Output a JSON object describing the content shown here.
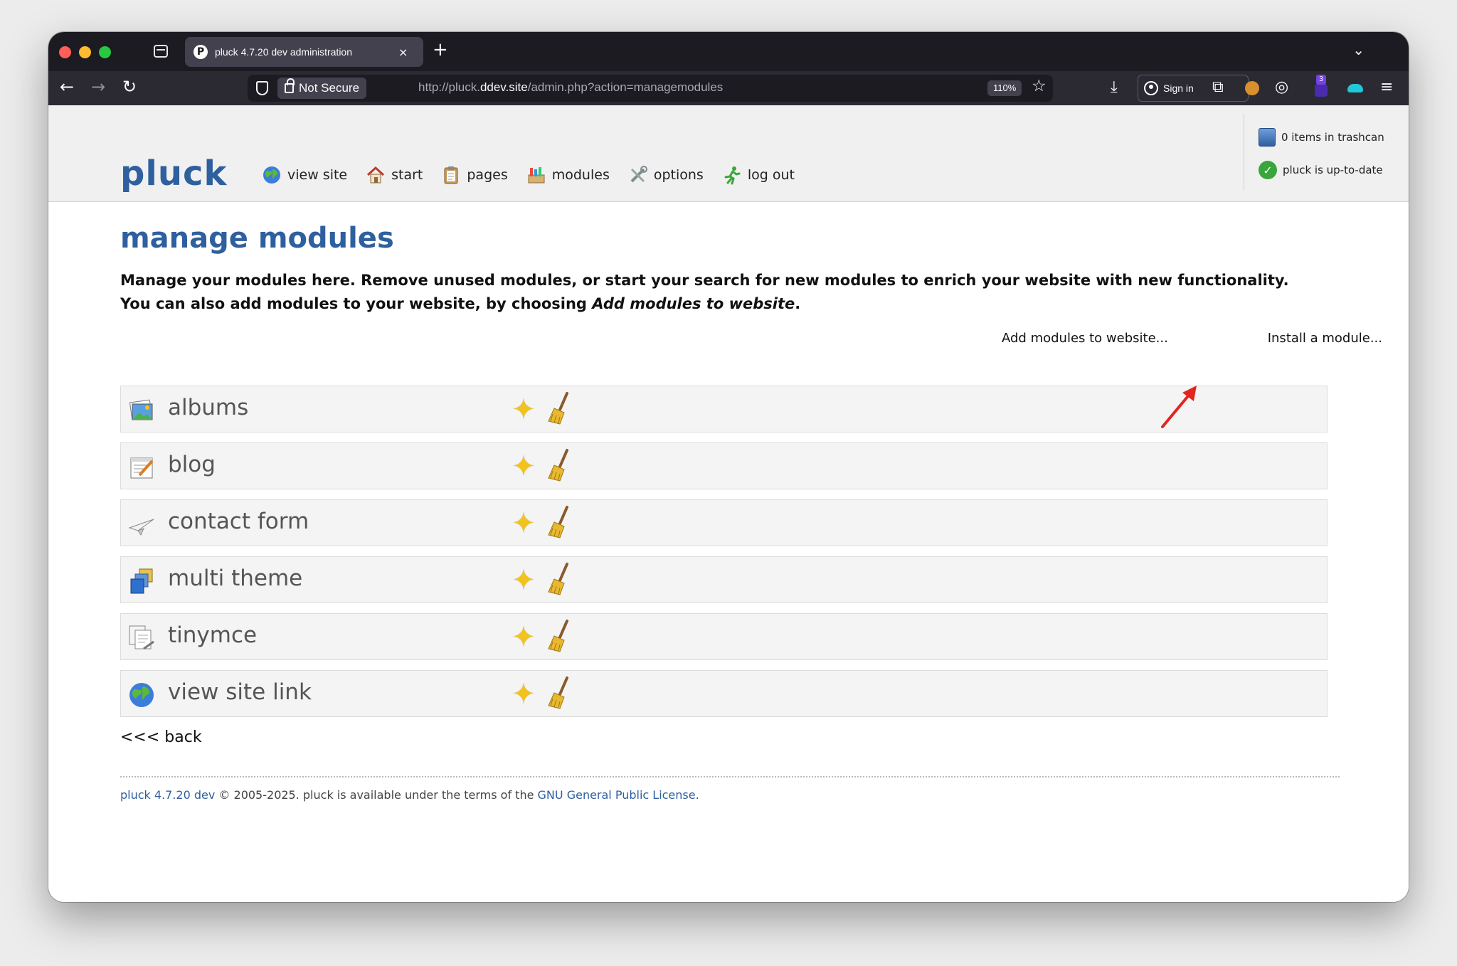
{
  "browser": {
    "tab_title": "pluck 4.7.20 dev administration",
    "tab_favicon": "P",
    "tab_close": "×",
    "new_tab": "+",
    "tab_overflow": "⌄",
    "security_label": "Not Secure",
    "url_prefix": "http://pluck.",
    "url_host": "ddev.site",
    "url_path": "/admin.php?action=managemodules",
    "zoom": "110%",
    "sign_in": "Sign in",
    "extension_badge": "3"
  },
  "header": {
    "logo": "pluck",
    "menu": [
      {
        "label": "view site",
        "icon": "globe-icon"
      },
      {
        "label": "start",
        "icon": "home-icon"
      },
      {
        "label": "pages",
        "icon": "clipboard-icon"
      },
      {
        "label": "modules",
        "icon": "modules-icon"
      },
      {
        "label": "options",
        "icon": "tools-icon"
      },
      {
        "label": "log out",
        "icon": "running-man-icon"
      }
    ],
    "trash_status": "0 items in trashcan",
    "update_status": "pluck is up-to-date"
  },
  "main": {
    "title": "manage modules",
    "intro_line1": "Manage your modules here. Remove unused modules, or start your search for new modules to enrich your website with new functionality.",
    "intro_line2_pre": "You can also add modules to your website, by choosing ",
    "intro_line2_em": "Add modules to website",
    "intro_line2_post": ".",
    "add_modules_link": "Add modules to website...",
    "install_module_link": "Install a module...",
    "modules": [
      {
        "name": "albums",
        "icon": "albums-icon"
      },
      {
        "name": "blog",
        "icon": "blog-icon"
      },
      {
        "name": "contact form",
        "icon": "contact-form-icon"
      },
      {
        "name": "multi theme",
        "icon": "multi-theme-icon"
      },
      {
        "name": "tinymce",
        "icon": "tinymce-icon"
      },
      {
        "name": "view site link",
        "icon": "globe-icon"
      }
    ],
    "star_glyph": "✦",
    "back_link": "<<< back"
  },
  "footer": {
    "version_link": "pluck 4.7.20 dev",
    "text": " © 2005-2025. pluck is available under the terms of the ",
    "license_link": "GNU General Public License",
    "end": "."
  },
  "colors": {
    "accent": "#2e5f9e",
    "annotation_arrow": "#e0261f"
  }
}
